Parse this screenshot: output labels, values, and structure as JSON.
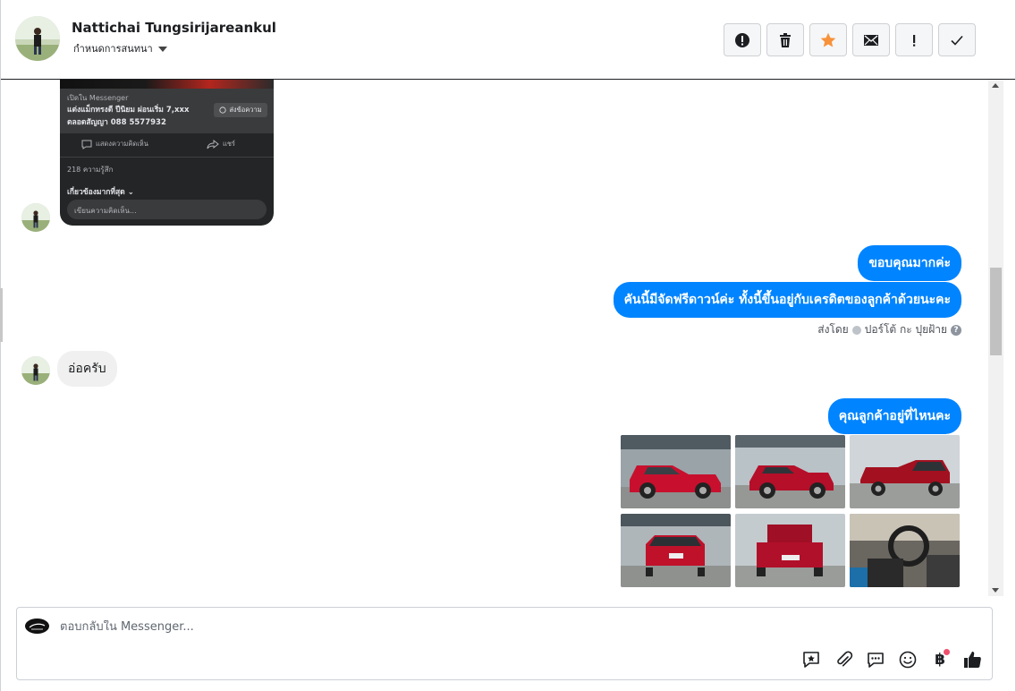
{
  "header": {
    "name": "Nattichai Tungsirijareankul",
    "subtitle": "กำหนดการสนทนา"
  },
  "toolbar": {
    "buttons": [
      {
        "icon": "alert-circle-icon"
      },
      {
        "icon": "trash-icon"
      },
      {
        "icon": "star-icon",
        "color": "#f7923a"
      },
      {
        "icon": "envelope-icon"
      },
      {
        "icon": "exclamation-icon"
      },
      {
        "icon": "check-icon"
      }
    ]
  },
  "screenshot": {
    "open_in": "เปิดใน Messenger",
    "promo_text": "แต่งแม็กทรงดี ปีนิยม ผ่อนเริ่ม 7,xxx ตลอดสัญญา 088 5577932",
    "send_button": "ส่งข้อความ",
    "comment_action": "แสดงความคิดเห็น",
    "share_action": "แชร์",
    "reactions": "218 ความรู้สึก",
    "most_relevant": "เกี่ยวข้องมากที่สุด",
    "comment_placeholder": "เขียนความคิดเห็น..."
  },
  "messages": {
    "out_1": "ขอบคุณมากค่ะ",
    "out_2": "คันนี้มีจัดฟรีดาวน์ค่ะ ทั้งนี้ขึ้นอยู่กับเครดิตของลูกค้าด้วยนะคะ",
    "sent_by_prefix": "ส่งโดย",
    "sent_by_name": "ปอร์โต้ กะ ปุยฝ้าย",
    "in_1": "อ่อครับ",
    "out_3": "คุณลูกค้าอยู่ที่ไหนคะ"
  },
  "composer": {
    "placeholder": "ตอบกลับใน Messenger...",
    "tools": [
      "saved-reply-icon",
      "paperclip-icon",
      "chat-bubble-icon",
      "emoji-icon",
      "baht-icon",
      "thumbs-up-icon"
    ],
    "baht_symbol": "฿"
  },
  "colors": {
    "accent": "#0084ff",
    "star": "#f7923a",
    "notification_dot": "#f0506e"
  }
}
